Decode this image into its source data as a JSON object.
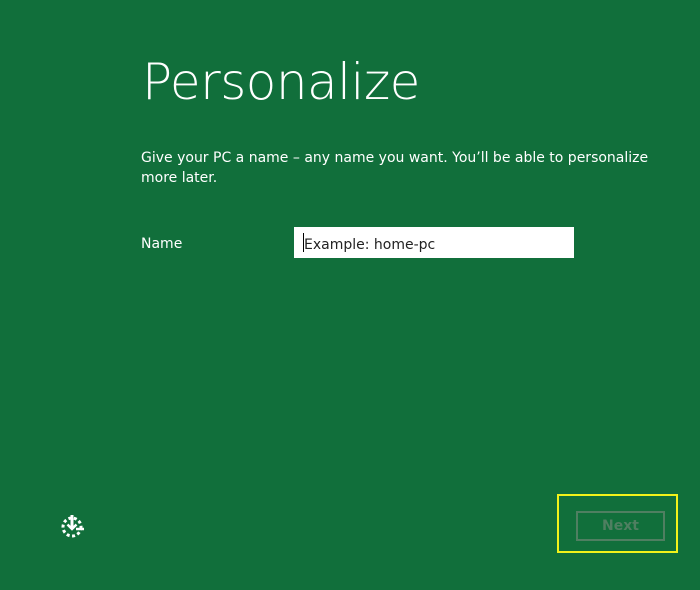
{
  "page": {
    "title": "Personalize",
    "description": "Give your PC a name – any name you want. You’ll be able to personalize more later."
  },
  "form": {
    "name_label": "Name",
    "name_value": "",
    "name_placeholder": "Example: home-pc"
  },
  "footer": {
    "ease_of_access_icon": "ease-of-access-icon",
    "next_label": "Next",
    "next_enabled": false
  },
  "colors": {
    "background": "#116f3b",
    "text": "#ffffff",
    "disabled_button": "#4f7f61",
    "highlight": "#f2f21a"
  }
}
